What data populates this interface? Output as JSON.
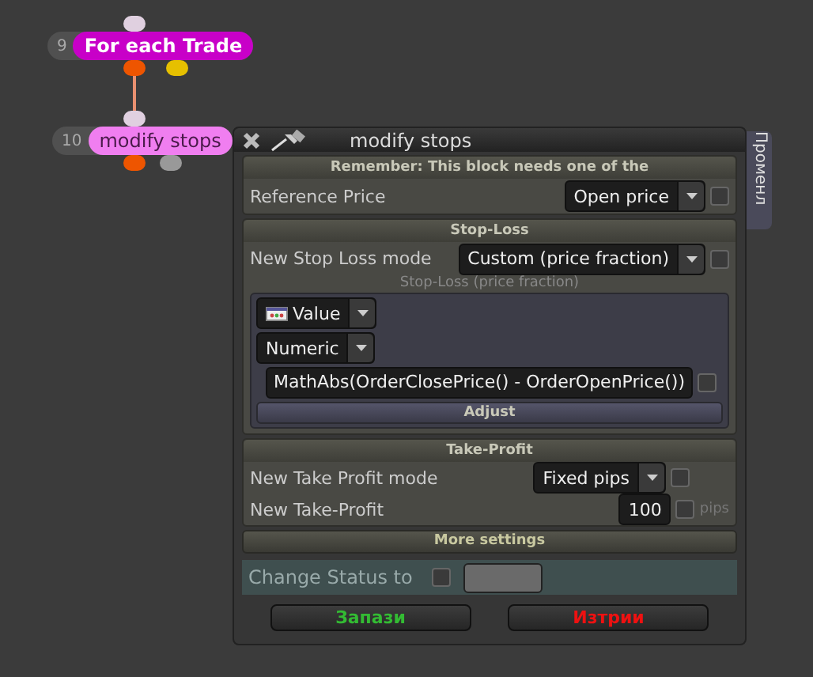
{
  "nodes": [
    {
      "number": "9",
      "label": "For each Trade",
      "color": "#c800c8"
    },
    {
      "number": "10",
      "label": "modify stops",
      "color": "#f07ef0"
    }
  ],
  "dialog": {
    "title": "modify stops",
    "side_tab": "Променл",
    "reminder": "Remember: This block needs one of the",
    "reference": {
      "label": "Reference Price",
      "value": "Open price",
      "checked": false
    },
    "stop_loss": {
      "header": "Stop-Loss",
      "mode_label": "New Stop Loss mode",
      "mode_value": "Custom (price fraction)",
      "mode_checked": false,
      "sub_label": "Stop-Loss (price fraction)",
      "source": "Value",
      "type": "Numeric",
      "expression": "MathAbs(OrderClosePrice() - OrderOpenPrice())",
      "expression_checked": false,
      "adjust": "Adjust"
    },
    "take_profit": {
      "header": "Take-Profit",
      "mode_label": "New Take Profit mode",
      "mode_value": "Fixed pips",
      "mode_checked": false,
      "value_label": "New Take-Profit",
      "value": "100",
      "value_checked": false,
      "unit": "pips"
    },
    "more": "More settings",
    "status": {
      "label": "Change Status to",
      "checked": false
    },
    "buttons": [
      {
        "label": "Запази",
        "kind": "save"
      },
      {
        "label": "Изтрии",
        "kind": "delete"
      }
    ]
  }
}
